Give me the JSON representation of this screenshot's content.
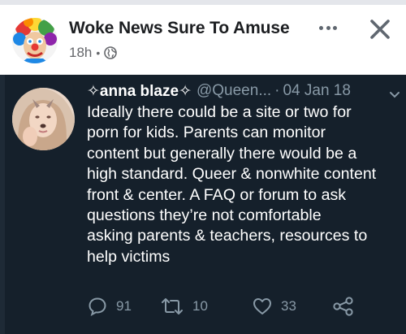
{
  "post": {
    "page_name": "Woke News Sure To Amuse",
    "time": "18h",
    "meta_separator": "•",
    "privacy_icon": "globe-icon",
    "more_icon": "more-dots-icon",
    "close_icon": "close-icon"
  },
  "tweet": {
    "display_name": "✧anna blaze✧",
    "handle": "@Queen...",
    "separator": "·",
    "date": "04 Jan 18",
    "caret_icon": "chevron-down-icon",
    "lines": [
      "Ideally there could be a site or two for",
      "porn for kids. Parents can monitor",
      "content but generally there would be a",
      "high standard. Queer & nonwhite content",
      "front & center. A FAQ or forum to ask",
      "questions they’re not comfortable",
      "asking parents & teachers, resources to",
      "help victims"
    ],
    "actions": {
      "replies": "91",
      "retweets": "10",
      "likes": "33",
      "share_icon": "share-icon"
    }
  },
  "colors": {
    "facebook_bg": "#ffffff",
    "facebook_text": "#1c1e21",
    "facebook_meta": "#65676b",
    "tweet_bg": "#15202b",
    "tweet_text": "#ffffff",
    "tweet_meta": "#8899a6"
  }
}
